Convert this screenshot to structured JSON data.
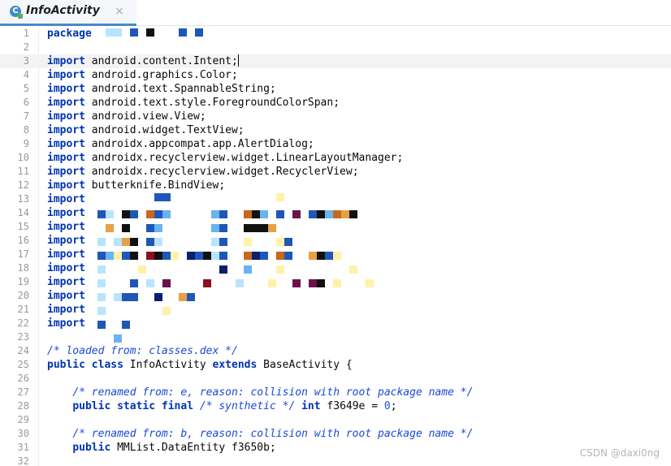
{
  "tab": {
    "title": "InfoActivity",
    "icon_letter": "C",
    "close_glyph": "×"
  },
  "editor": {
    "lines": [
      {
        "n": "1",
        "parts": [
          {
            "t": "package",
            "c": "kw"
          }
        ]
      },
      {
        "n": "2",
        "parts": []
      },
      {
        "n": "3",
        "parts": [
          {
            "t": "import",
            "c": "kw"
          },
          {
            "t": " android.content.Intent;",
            "c": ""
          }
        ],
        "current": true
      },
      {
        "n": "4",
        "parts": [
          {
            "t": "import",
            "c": "kw"
          },
          {
            "t": " android.graphics.Color;",
            "c": ""
          }
        ]
      },
      {
        "n": "5",
        "parts": [
          {
            "t": "import",
            "c": "kw"
          },
          {
            "t": " android.text.SpannableString;",
            "c": ""
          }
        ]
      },
      {
        "n": "6",
        "parts": [
          {
            "t": "import",
            "c": "kw"
          },
          {
            "t": " android.text.style.ForegroundColorSpan;",
            "c": ""
          }
        ]
      },
      {
        "n": "7",
        "parts": [
          {
            "t": "import",
            "c": "kw"
          },
          {
            "t": " android.view.View;",
            "c": ""
          }
        ]
      },
      {
        "n": "8",
        "parts": [
          {
            "t": "import",
            "c": "kw"
          },
          {
            "t": " android.widget.TextView;",
            "c": ""
          }
        ]
      },
      {
        "n": "9",
        "parts": [
          {
            "t": "import",
            "c": "kw"
          },
          {
            "t": " androidx.appcompat.app.AlertDialog;",
            "c": ""
          }
        ]
      },
      {
        "n": "10",
        "parts": [
          {
            "t": "import",
            "c": "kw"
          },
          {
            "t": " androidx.recyclerview.widget.LinearLayoutManager;",
            "c": ""
          }
        ]
      },
      {
        "n": "11",
        "parts": [
          {
            "t": "import",
            "c": "kw"
          },
          {
            "t": " androidx.recyclerview.widget.RecyclerView;",
            "c": ""
          }
        ]
      },
      {
        "n": "12",
        "parts": [
          {
            "t": "import",
            "c": "kw"
          },
          {
            "t": " butterknife.BindView;",
            "c": ""
          }
        ]
      },
      {
        "n": "13",
        "parts": [
          {
            "t": "import",
            "c": "kw"
          }
        ]
      },
      {
        "n": "14",
        "parts": [
          {
            "t": "import",
            "c": "kw"
          }
        ]
      },
      {
        "n": "15",
        "parts": [
          {
            "t": "import",
            "c": "kw"
          }
        ]
      },
      {
        "n": "16",
        "parts": [
          {
            "t": "import",
            "c": "kw"
          }
        ]
      },
      {
        "n": "17",
        "parts": [
          {
            "t": "import",
            "c": "kw"
          }
        ]
      },
      {
        "n": "18",
        "parts": [
          {
            "t": "import",
            "c": "kw"
          }
        ]
      },
      {
        "n": "19",
        "parts": [
          {
            "t": "import",
            "c": "kw"
          }
        ]
      },
      {
        "n": "20",
        "parts": [
          {
            "t": "import",
            "c": "kw"
          }
        ]
      },
      {
        "n": "21",
        "parts": [
          {
            "t": "import",
            "c": "kw"
          }
        ]
      },
      {
        "n": "22",
        "parts": [
          {
            "t": "import",
            "c": "kw"
          }
        ]
      },
      {
        "n": "23",
        "parts": []
      },
      {
        "n": "24",
        "parts": [
          {
            "t": "/* loaded from: classes.dex */",
            "c": "cm"
          }
        ]
      },
      {
        "n": "25",
        "parts": [
          {
            "t": "public",
            "c": "kw"
          },
          {
            "t": " ",
            "c": ""
          },
          {
            "t": "class",
            "c": "kw"
          },
          {
            "t": " InfoActivity ",
            "c": ""
          },
          {
            "t": "extends",
            "c": "kw"
          },
          {
            "t": " BaseActivity {",
            "c": ""
          }
        ]
      },
      {
        "n": "26",
        "parts": []
      },
      {
        "n": "27",
        "parts": [
          {
            "t": "    ",
            "c": ""
          },
          {
            "t": "/* renamed from: e, reason: collision with root package name */",
            "c": "cm"
          }
        ]
      },
      {
        "n": "28",
        "parts": [
          {
            "t": "    ",
            "c": ""
          },
          {
            "t": "public",
            "c": "kw"
          },
          {
            "t": " ",
            "c": ""
          },
          {
            "t": "static",
            "c": "kw"
          },
          {
            "t": " ",
            "c": ""
          },
          {
            "t": "final",
            "c": "kw"
          },
          {
            "t": " ",
            "c": ""
          },
          {
            "t": "/* synthetic */",
            "c": "cm"
          },
          {
            "t": " ",
            "c": ""
          },
          {
            "t": "int",
            "c": "kw"
          },
          {
            "t": " f3649e = ",
            "c": ""
          },
          {
            "t": "0",
            "c": "num"
          },
          {
            "t": ";",
            "c": ""
          }
        ]
      },
      {
        "n": "29",
        "parts": []
      },
      {
        "n": "30",
        "parts": [
          {
            "t": "    ",
            "c": ""
          },
          {
            "t": "/* renamed from: b, reason: collision with root package name */",
            "c": "cm"
          }
        ]
      },
      {
        "n": "31",
        "parts": [
          {
            "t": "    ",
            "c": ""
          },
          {
            "t": "public",
            "c": "kw"
          },
          {
            "t": " MMList.DataEntity f3650b;",
            "c": ""
          }
        ]
      },
      {
        "n": "32",
        "parts": []
      }
    ]
  },
  "colors": {
    "keyword": "#0033b3",
    "comment": "#1a48d8",
    "number": "#1750eb",
    "tab_underline": "#4a88c7",
    "current_line": "#f3f3f3",
    "redaction_palette": [
      "#1f57b8",
      "#6ab3f0",
      "#0a1f6e",
      "#111111",
      "#e8a047",
      "#8a1020",
      "#b8e4ff",
      "#fff1a8",
      "#6a114e",
      "#c6681d"
    ]
  },
  "watermark": "CSDN @daxi0ng"
}
